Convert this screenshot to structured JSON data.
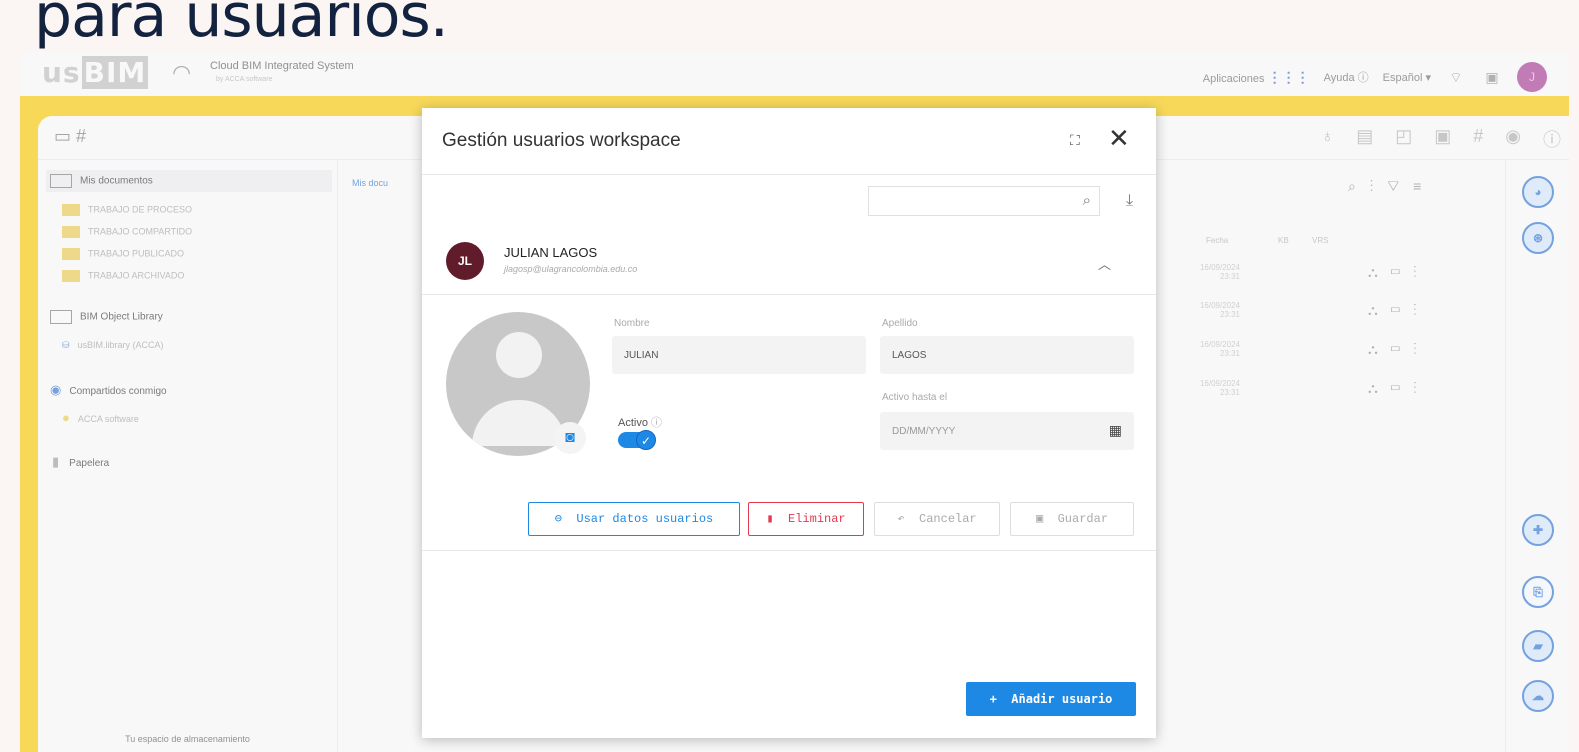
{
  "slide": {
    "heading": "para usuarios."
  },
  "app": {
    "logo_left": "us",
    "logo_right": "BIM",
    "system_name": "Cloud BIM Integrated System",
    "system_by": "by ACCA software",
    "apps_label": "Aplicaciones",
    "help_label": "Ayuda",
    "language": "Español",
    "profile_initial": "J"
  },
  "sidebar": {
    "items": [
      {
        "label": "Mis documentos"
      },
      {
        "label": "TRABAJO DE PROCESO"
      },
      {
        "label": "TRABAJO COMPARTIDO"
      },
      {
        "label": "TRABAJO PUBLICADO"
      },
      {
        "label": "TRABAJO ARCHIVADO"
      },
      {
        "label": "BIM Object Library"
      },
      {
        "label": "usBIM.library (ACCA)"
      },
      {
        "label": "Compartidos conmigo"
      },
      {
        "label": "ACCA software"
      },
      {
        "label": "Papelera"
      }
    ],
    "storage_label": "Tu espacio de almacenamiento"
  },
  "content": {
    "breadcrumb": "Mis docu",
    "col_date": "Fecha",
    "col_kb": "KB",
    "col_vrs": "VRS",
    "rows": [
      {
        "date": "16/09/2024",
        "time": "23:31"
      },
      {
        "date": "16/09/2024",
        "time": "23:31"
      },
      {
        "date": "16/09/2024",
        "time": "23:31"
      },
      {
        "date": "16/09/2024",
        "time": "23:31"
      }
    ]
  },
  "modal": {
    "title": "Gestión usuarios workspace",
    "user": {
      "initials": "JL",
      "name": "JULIAN LAGOS",
      "email": "jlagosp@ulagrancolombia.edu.co"
    },
    "fields": {
      "nombre_label": "Nombre",
      "nombre_value": "JULIAN",
      "apellido_label": "Apellido",
      "apellido_value": "LAGOS",
      "activo_hasta_label": "Activo hasta el",
      "activo_hasta_placeholder": "DD/MM/YYYY",
      "activo_label": "Activo",
      "activo_on": true
    },
    "buttons": {
      "use_data": "Usar datos usuarios",
      "delete": "Eliminar",
      "cancel": "Cancelar",
      "save": "Guardar",
      "add_user": "Añadir usuario"
    }
  }
}
